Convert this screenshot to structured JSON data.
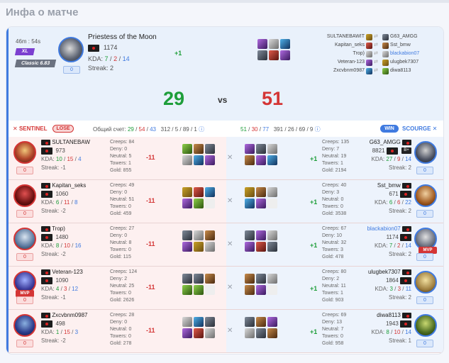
{
  "page": {
    "title": "Инфа о матче"
  },
  "summary": {
    "duration": "46m : 54s",
    "tag": "XL",
    "mode": "Classic 6.83",
    "hero_level": "0",
    "hero_name": "Priestess of the Moon",
    "rating": "1174",
    "kda": {
      "label": "KDA:",
      "k": "7",
      "d": "2",
      "a": "14"
    },
    "streak": "Streak: 2",
    "delta": "+1",
    "score_left": "29",
    "vs": "vs",
    "score_right": "51",
    "list_left": [
      "SULTANEBAWIT",
      "Kapitan_seks",
      "Trop)",
      "Veteran-123",
      "Zxcvbnm0987"
    ],
    "list_right": [
      "G63_AMGG",
      "Sst_bmw",
      "blackabion07",
      "ulugbek7307",
      "diwa8113"
    ]
  },
  "teambar": {
    "sentinel": "SENTINEL",
    "lose": "LOSE",
    "score_label": "Общий счет:",
    "left_stats": [
      "29",
      "/",
      "54",
      "/",
      "43",
      "312",
      "/",
      "5",
      "/",
      "89",
      "/",
      "1"
    ],
    "right_stats": [
      "51",
      "/",
      "30",
      "/",
      "77",
      "391",
      "/",
      "26",
      "/",
      "69",
      "/",
      "9"
    ],
    "win": "WIN",
    "scourge": "SCOURGE"
  },
  "rows": [
    {
      "left": {
        "name": "SULTANEBAW",
        "rating": "973",
        "k": "10",
        "d": "15",
        "a": "4",
        "streak": "Streak: -1",
        "level": "0",
        "creeps": "Creeps: 84",
        "deny": "Deny: 0",
        "neutral": "Neutral: 5",
        "towers": "Towers: 1",
        "gold": "Gold: 855",
        "delta": "-11",
        "mvp": ""
      },
      "right": {
        "name": "G63_AMGG",
        "rating": "8821",
        "rank": "B+",
        "k": "27",
        "d": "9",
        "a": "14",
        "streak": "Streak: 2",
        "level": "0",
        "creeps": "Creeps: 135",
        "deny": "Deny: 7",
        "neutral": "Neutral: 19",
        "towers": "Towers: 1",
        "gold": "Gold: 2194",
        "delta": "+1",
        "mvp": ""
      }
    },
    {
      "left": {
        "name": "Kapitan_seks",
        "rating": "1060",
        "k": "6",
        "d": "11",
        "a": "8",
        "streak": "Streak: -2",
        "level": "0",
        "creeps": "Creeps: 49",
        "deny": "Deny: 0",
        "neutral": "Neutral: 51",
        "towers": "Towers: 0",
        "gold": "Gold: 459",
        "delta": "-11",
        "mvp": ""
      },
      "right": {
        "name": "Sst_bmw",
        "rating": "671",
        "rank": "",
        "k": "6",
        "d": "6",
        "a": "22",
        "streak": "Streak: 2",
        "level": "0",
        "creeps": "Creeps: 40",
        "deny": "Deny: 3",
        "neutral": "Neutral: 0",
        "towers": "Towers: 0",
        "gold": "Gold: 3538",
        "delta": "+1",
        "mvp": ""
      }
    },
    {
      "left": {
        "name": "Trop)",
        "rating": "1480",
        "k": "8",
        "d": "10",
        "a": "16",
        "streak": "Streak: -2",
        "level": "0",
        "creeps": "Creeps: 27",
        "deny": "Deny: 0",
        "neutral": "Neutral: 8",
        "towers": "Towers: 0",
        "gold": "Gold: 115",
        "delta": "-11",
        "mvp": ""
      },
      "right": {
        "name": "blackabion07",
        "rating": "1174",
        "rank": "",
        "k": "7",
        "d": "2",
        "a": "14",
        "streak": "Streak: 2",
        "level": "0",
        "creeps": "Creeps: 67",
        "deny": "Deny: 10",
        "neutral": "Neutral: 32",
        "towers": "Towers: 3",
        "gold": "Gold: 478",
        "delta": "+1",
        "mvp": "MVP"
      }
    },
    {
      "left": {
        "name": "Veteran-123",
        "rating": "1090",
        "k": "4",
        "d": "3",
        "a": "12",
        "streak": "Streak: -1",
        "level": "0",
        "creeps": "Creeps: 124",
        "deny": "Deny: 2",
        "neutral": "Neutral: 25",
        "towers": "Towers: 0",
        "gold": "Gold: 2626",
        "delta": "-11",
        "mvp": "MVP"
      },
      "right": {
        "name": "ulugbek7307",
        "rating": "1864",
        "rank": "",
        "k": "3",
        "d": "3",
        "a": "11",
        "streak": "Streak: 2",
        "level": "0",
        "creeps": "Creeps: 80",
        "deny": "Deny: 2",
        "neutral": "Neutral: 11",
        "towers": "Towers: 1",
        "gold": "Gold: 903",
        "delta": "+1",
        "mvp": ""
      }
    },
    {
      "left": {
        "name": "Zxcvbnm0987",
        "rating": "498",
        "k": "1",
        "d": "15",
        "a": "3",
        "streak": "Streak: -2",
        "level": "0",
        "creeps": "Creeps: 28",
        "deny": "Deny: 0",
        "neutral": "Neutral: 0",
        "towers": "Towers: 0",
        "gold": "Gold: 278",
        "delta": "-11",
        "mvp": ""
      },
      "right": {
        "name": "diwa8113",
        "rating": "1943",
        "rank": "",
        "k": "8",
        "d": "10",
        "a": "14",
        "streak": "Streak: 1",
        "level": "0",
        "creeps": "Creeps: 69",
        "deny": "Deny: 13",
        "neutral": "Neutral: 7",
        "towers": "Towers: 0",
        "gold": "Gold: 958",
        "delta": "+1",
        "mvp": ""
      }
    }
  ],
  "labels": {
    "kda": "KDA:",
    "slash": "/"
  }
}
